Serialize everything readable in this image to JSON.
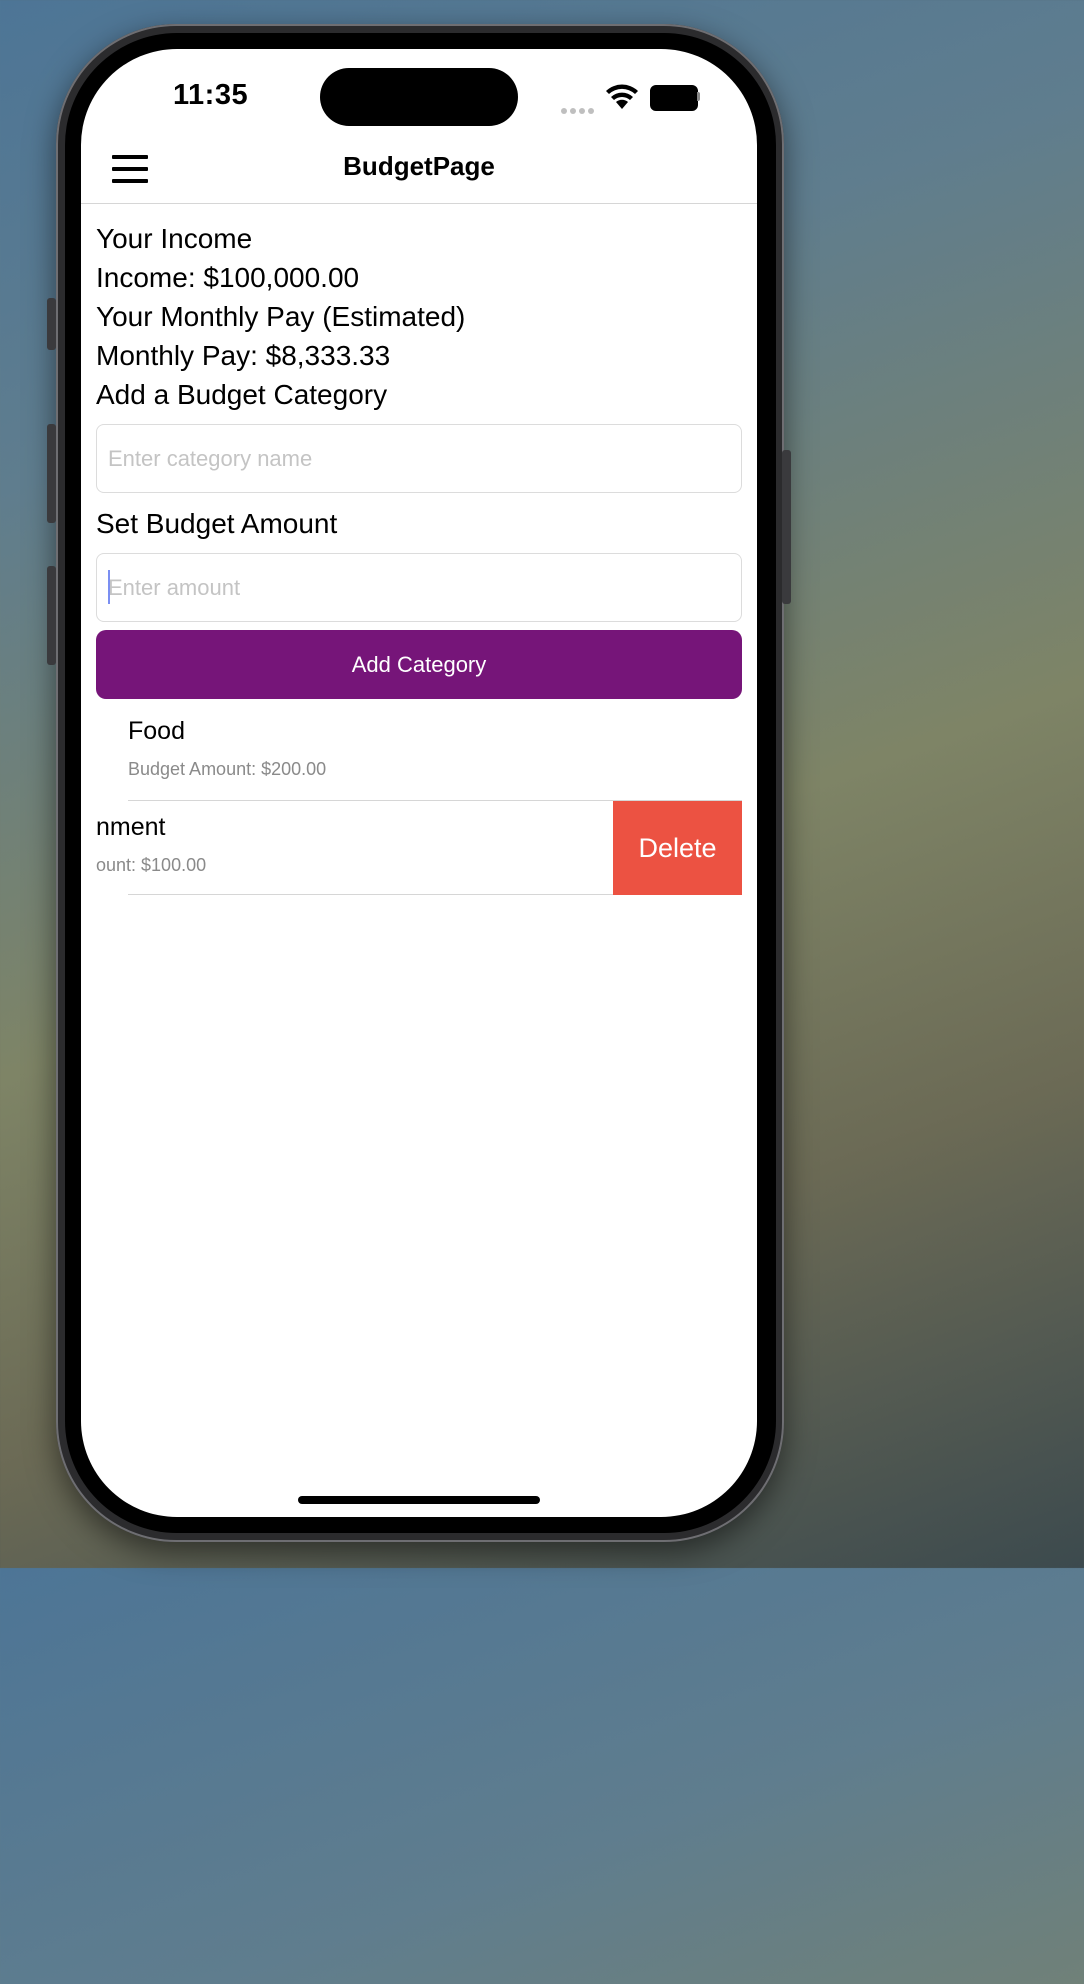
{
  "status_bar": {
    "time": "11:35"
  },
  "nav": {
    "title": "BudgetPage"
  },
  "income": {
    "heading": "Your Income",
    "income_line": "Income: $100,000.00",
    "monthly_heading": "Your Monthly Pay (Estimated)",
    "monthly_line": "Monthly Pay: $8,333.33"
  },
  "form": {
    "category_label": "Add a Budget Category",
    "category_placeholder": "Enter category name",
    "amount_label": "Set Budget Amount",
    "amount_placeholder": "Enter amount",
    "submit_label": "Add Category"
  },
  "categories": [
    {
      "name": "Food",
      "amount": "Budget Amount: $200.00"
    },
    {
      "name": "nment",
      "amount": "ount: $100.00",
      "swipe_action": "Delete"
    }
  ],
  "colors": {
    "accent": "#761579",
    "delete": "#ec5242"
  }
}
